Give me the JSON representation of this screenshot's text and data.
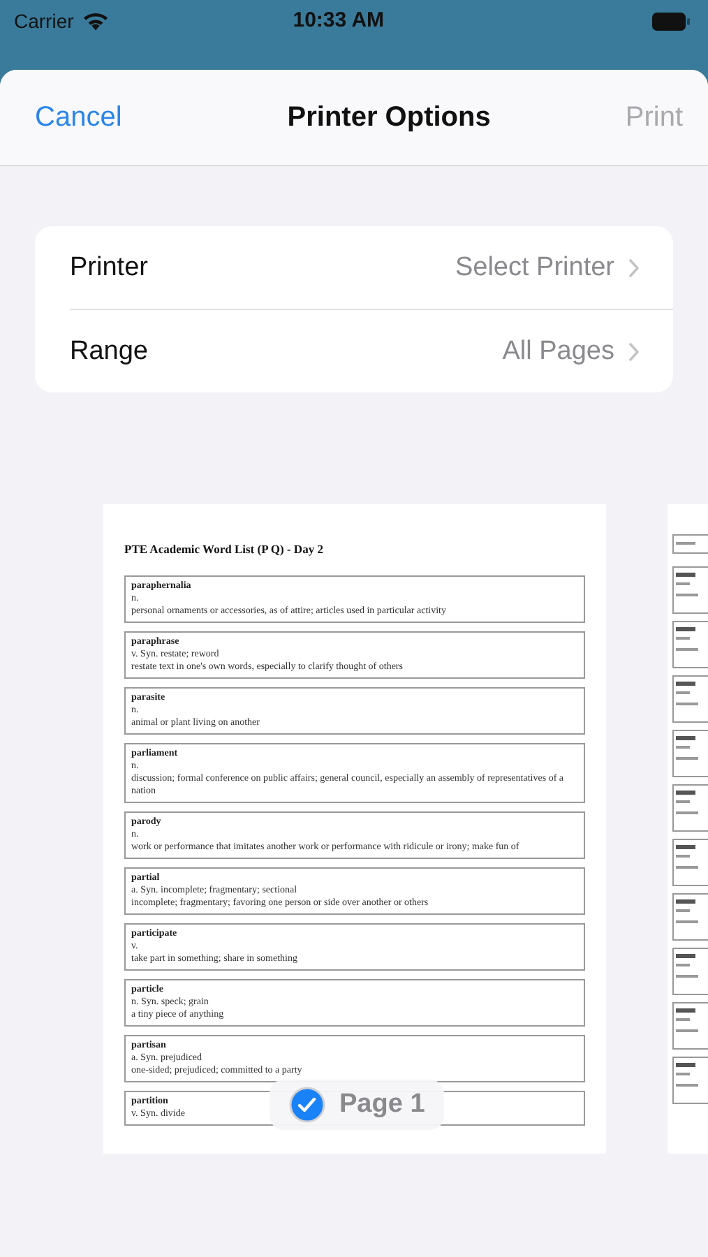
{
  "status_bar": {
    "carrier": "Carrier",
    "time": "10:33 AM"
  },
  "sheet": {
    "cancel": "Cancel",
    "title": "Printer Options",
    "print": {
      "label": "Print",
      "disabled": true
    }
  },
  "options": [
    {
      "label": "Printer",
      "value": "Select Printer"
    },
    {
      "label": "Range",
      "value": "All Pages"
    }
  ],
  "preview": {
    "title": "PTE Academic Word List (P Q) - Day 2",
    "entries": [
      {
        "word": "paraphernalia",
        "pos": "n.",
        "definition": "personal ornaments or accessories, as of attire; articles used in particular activity"
      },
      {
        "word": "paraphrase",
        "pos": "v. Syn. restate; reword",
        "definition": "restate text in one's own words, especially to clarify thought of others"
      },
      {
        "word": "parasite",
        "pos": "n.",
        "definition": "animal or plant living on another"
      },
      {
        "word": "parliament",
        "pos": "n.",
        "definition": "discussion; formal conference on public affairs; general council, especially an assembly of representatives of a nation"
      },
      {
        "word": "parody",
        "pos": "n.",
        "definition": "work or performance that imitates another work or performance with ridicule or irony; make fun of"
      },
      {
        "word": "partial",
        "pos": "a. Syn. incomplete; fragmentary; sectional",
        "definition": "incomplete; fragmentary; favoring one person or side over another or others"
      },
      {
        "word": "participate",
        "pos": "v.",
        "definition": "take part in something; share in something"
      },
      {
        "word": "particle",
        "pos": "n. Syn. speck; grain",
        "definition": "a tiny piece of anything"
      },
      {
        "word": "partisan",
        "pos": "a. Syn. prejudiced",
        "definition": "one-sided; prejudiced; committed to a party"
      },
      {
        "word": "partition",
        "pos": "v. Syn. divide"
      }
    ],
    "page_badge": {
      "label": "Page 1",
      "selected": true
    }
  }
}
